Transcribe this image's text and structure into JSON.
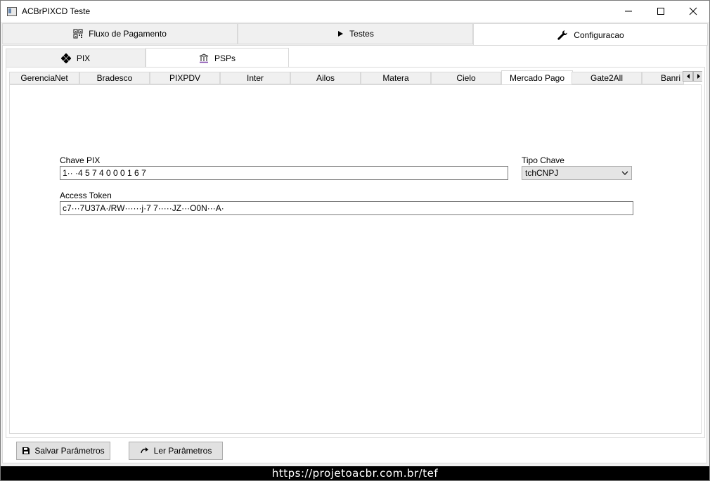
{
  "window": {
    "title": "ACBrPIXCD Teste"
  },
  "main_tabs": [
    {
      "label": "Fluxo de Pagamento",
      "icon": "qr-code-icon"
    },
    {
      "label": "Testes",
      "icon": "play-icon"
    },
    {
      "label": "Configuracao",
      "icon": "wrench-icon"
    }
  ],
  "sub_tabs": [
    {
      "label": "PIX",
      "icon": "pix-diamond-icon"
    },
    {
      "label": "PSPs",
      "icon": "bank-icon"
    }
  ],
  "psp_tabs": [
    "GerenciaNet",
    "Bradesco",
    "PIXPDV",
    "Inter",
    "Ailos",
    "Matera",
    "Cielo",
    "Mercado Pago",
    "Gate2All",
    "Banri"
  ],
  "active_psp": "Mercado Pago",
  "form": {
    "chave_label": "Chave PIX",
    "chave_value": "1·· ·4 5 7 4 0 0 0 1 6 7",
    "tipo_label": "Tipo Chave",
    "tipo_value": "tchCNPJ",
    "token_label": "Access Token",
    "token_value": "c7···7U37A·/RW······j·7 7·····JZ···O0N···A·"
  },
  "buttons": {
    "save": "Salvar Parâmetros",
    "load": "Ler Parâmetros"
  },
  "status": "https://projetoacbr.com.br/tef"
}
